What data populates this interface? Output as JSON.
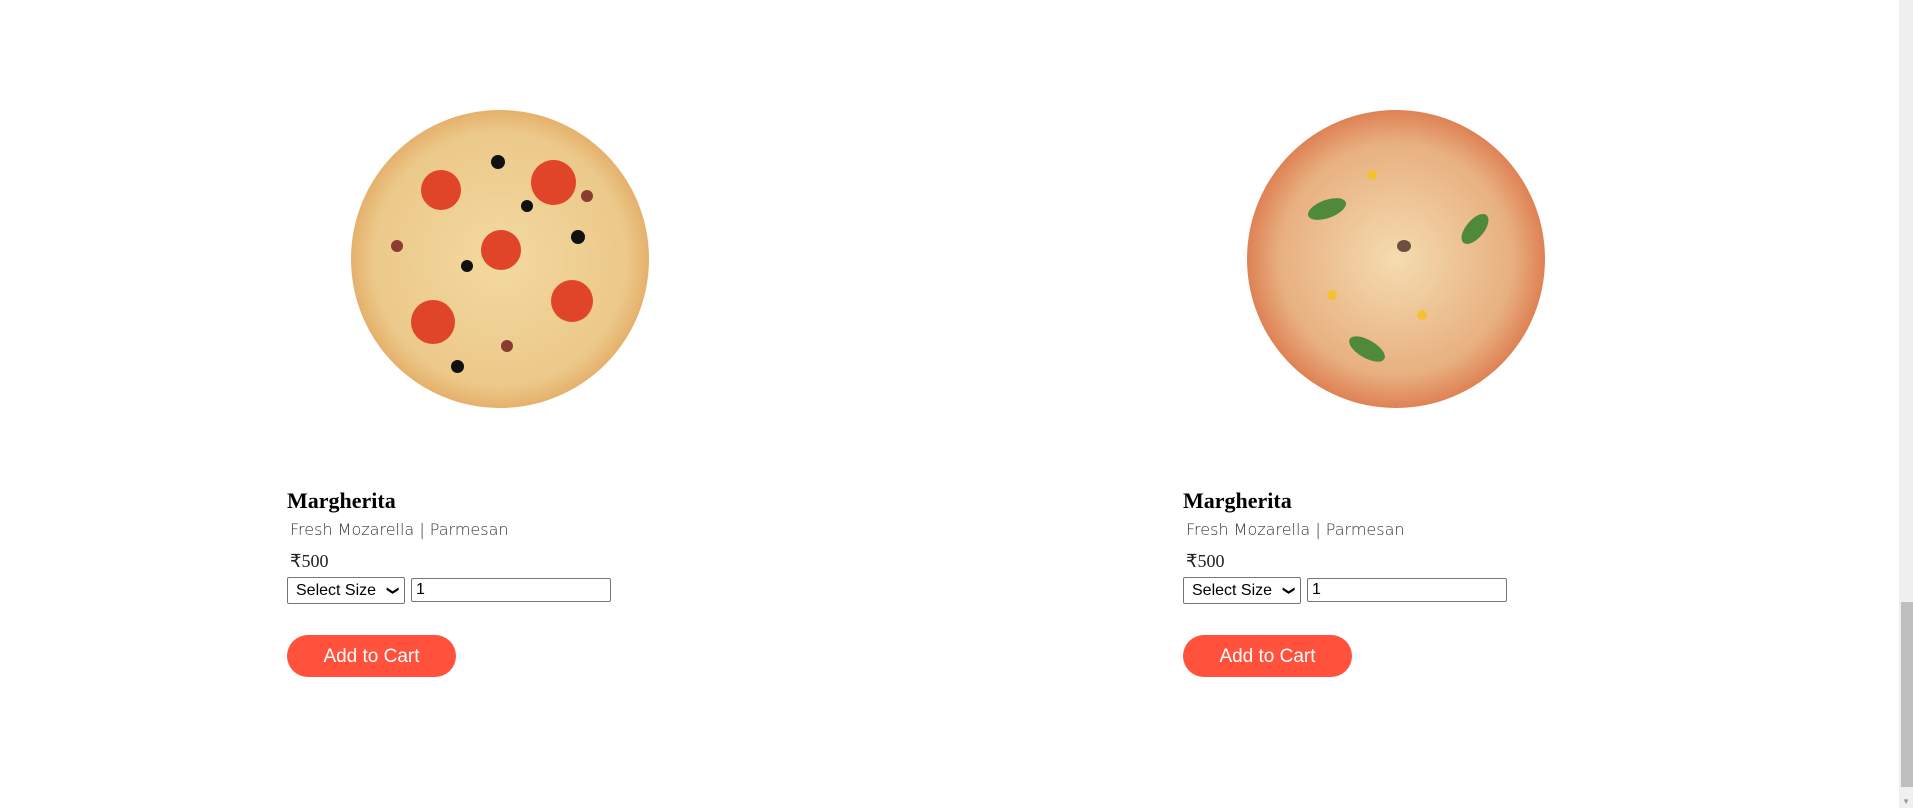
{
  "products": [
    {
      "name": "Margherita",
      "description": "Fresh Mozarella | Parmesan",
      "price": "₹500",
      "size_select": "Select Size",
      "quantity": "1",
      "button": "Add to Cart"
    },
    {
      "name": "Margherita",
      "description": "Fresh Mozarella | Parmesan",
      "price": "₹500",
      "size_select": "Select Size",
      "quantity": "1",
      "button": "Add to Cart"
    }
  ],
  "colors": {
    "button": "#ff513c"
  }
}
